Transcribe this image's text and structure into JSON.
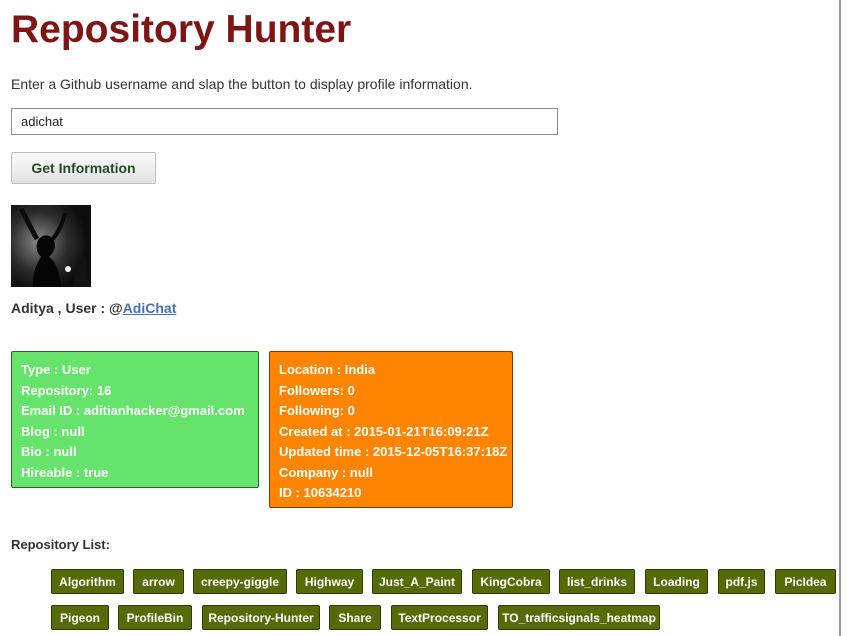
{
  "header": {
    "title": "Repository Hunter",
    "description": "Enter a Github username and slap the button to display profile information."
  },
  "search": {
    "value": "adichat",
    "button_label": "Get Information"
  },
  "profile": {
    "name_prefix": "Aditya , User : @",
    "username_link": "AdiChat"
  },
  "info_left": [
    "Type : User",
    "Repository: 16",
    "Email ID : aditianhacker@gmail.com",
    "Blog : null",
    "Bio : null",
    "Hireable : true"
  ],
  "info_right": [
    "Location : India",
    "Followers: 0",
    "Following: 0",
    "Created at : 2015-01-21T16:09:21Z",
    "Updated time : 2015-12-05T16:37:18Z",
    "Company : null",
    "ID : 10634210"
  ],
  "repo_list_label": "Repository List:",
  "repos": [
    "Algorithm",
    "arrow",
    "creepy-giggle",
    "Highway",
    "Just_A_Paint",
    "KingCobra",
    "list_drinks",
    "Loading",
    "pdf.js",
    "PicIdea",
    "Pigeon",
    "ProfileBin",
    "Repository-Hunter",
    "Share",
    "TextProcessor",
    "TO_trafficsignals_heatmap"
  ],
  "colors": {
    "title": "#7e1414",
    "green_card": "#66e36a",
    "orange_card": "#ff8500",
    "repo_button": "#556b07",
    "link": "#4a6fb5"
  }
}
